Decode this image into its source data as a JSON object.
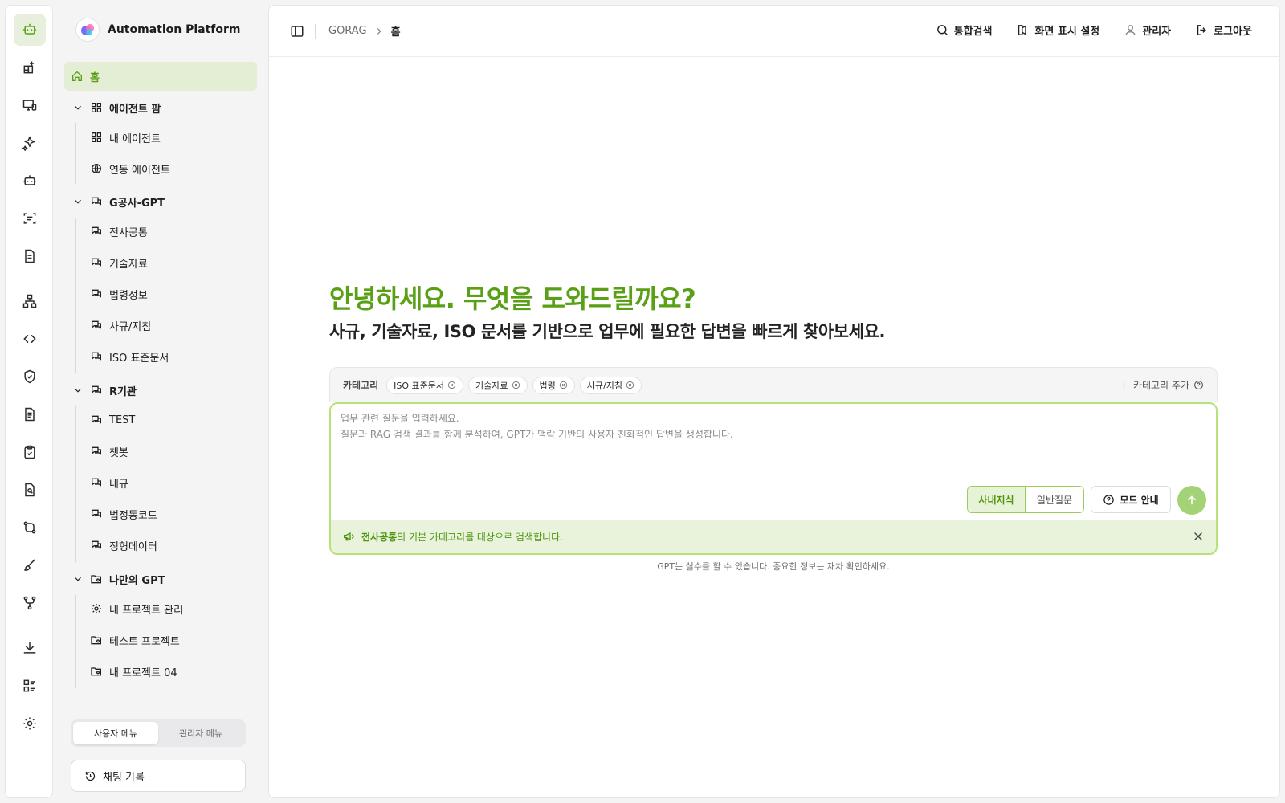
{
  "app": {
    "name": "Automation Platform"
  },
  "rail": {
    "icons": [
      "bot-icon",
      "grid-plus-icon",
      "monitor-icon",
      "sparkles-icon",
      "robot-icon",
      "scan-text-icon",
      "file-text-icon",
      "network-icon",
      "code-icon",
      "shield-check-icon",
      "file-lines-icon",
      "clipboard-check-icon",
      "file-search-icon",
      "git-compare-icon",
      "brush-icon",
      "git-fork-icon",
      "download-icon",
      "list-grid-icon",
      "settings-icon"
    ]
  },
  "sidebar": {
    "home": "홈",
    "groups": [
      {
        "label": "에이전트 팜",
        "children": [
          "내 에이전트",
          "연동 에이전트"
        ]
      },
      {
        "label": "G공사-GPT",
        "children": [
          "전사공통",
          "기술자료",
          "법령정보",
          "사규/지침",
          "ISO 표준문서"
        ]
      },
      {
        "label": "R기관",
        "children": [
          "TEST",
          "챗봇",
          "내규",
          "법정동코드",
          "정형데이터"
        ]
      },
      {
        "label": "나만의 GPT",
        "children": [
          "내 프로젝트 관리",
          "테스트 프로젝트",
          "내 프로젝트 04"
        ]
      }
    ],
    "segments": {
      "user": "사용자 메뉴",
      "admin": "관리자 메뉴"
    },
    "history": "채팅 기록"
  },
  "header": {
    "breadcrumb": [
      "GORAG",
      "홈"
    ],
    "actions": {
      "search": "통합검색",
      "display": "화면 표시 설정",
      "user": "관리자",
      "logout": "로그아웃"
    }
  },
  "hero": {
    "title": "안녕하세요. 무엇을 도와드릴까요?",
    "subtitle": "사규, 기술자료, ISO 문서를 기반으로 업무에 필요한 답변을 빠르게 찾아보세요."
  },
  "composer": {
    "category_label": "카테고리",
    "chips": [
      "ISO 표준문서",
      "기술자료",
      "법령",
      "사규/지침"
    ],
    "add_category": "카테고리 추가",
    "placeholder": "업무 관련 질문을 입력하세요.\n질문과 RAG 검색 결과를 함께 분석하여, GPT가 맥락 기반의 사용자 친화적인 답변을 생성합니다.",
    "modes": [
      "사내지식",
      "일반질문"
    ],
    "mode_guide": "모드 안내",
    "notice_bold": "전사공통",
    "notice_rest": "의 기본 카테고리를 대상으로 검색합니다."
  },
  "disclaimer": "GPT는 실수를 할 수 있습니다. 중요한 정보는 재차 확인하세요.",
  "colors": {
    "accent": "#5aa016",
    "accent_light": "#e3eed5",
    "send": "#a4d276"
  }
}
